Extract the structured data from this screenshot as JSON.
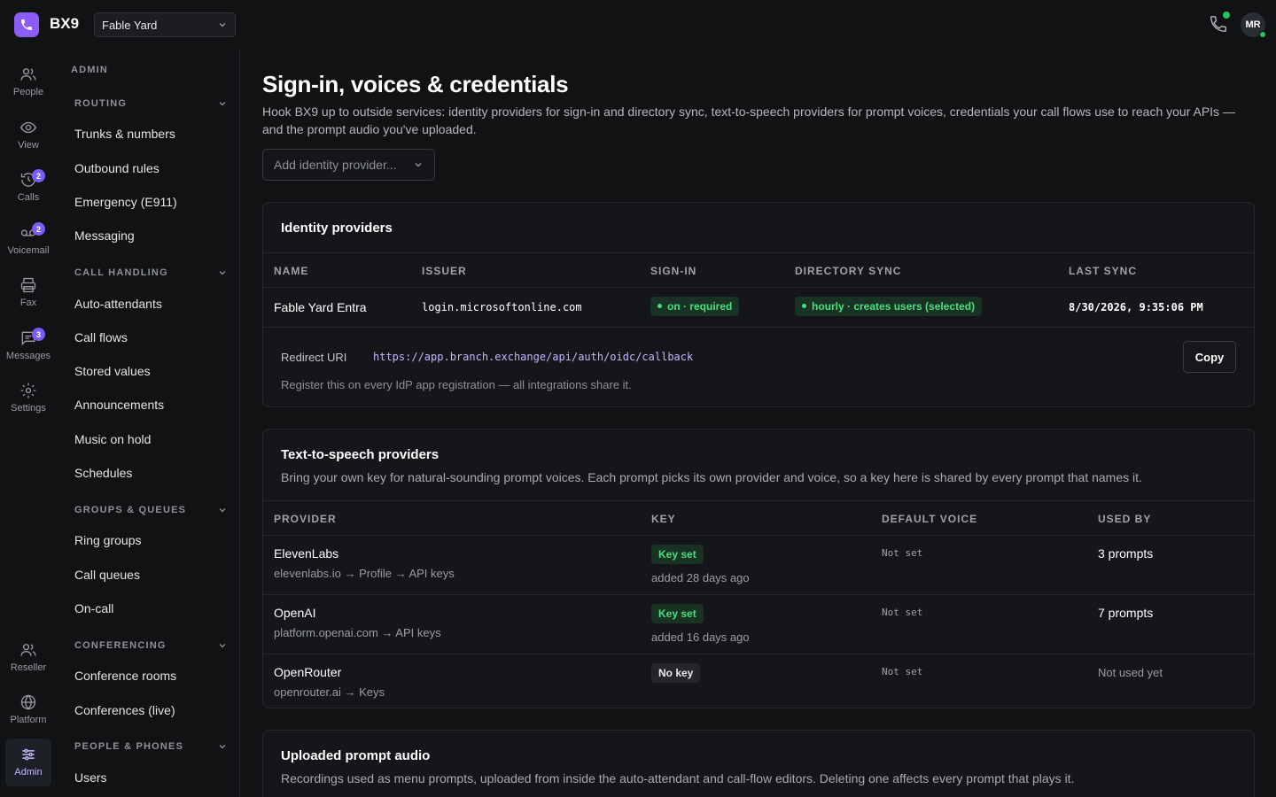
{
  "app": {
    "name": "BX9",
    "org": "Fable Yard",
    "user_initials": "MR"
  },
  "rail": [
    {
      "label": "People",
      "icon": "people-icon"
    },
    {
      "label": "View",
      "icon": "eye-icon"
    },
    {
      "label": "Calls",
      "icon": "history-icon",
      "badge": "2"
    },
    {
      "label": "Voicemail",
      "icon": "voicemail-icon",
      "badge": "2"
    },
    {
      "label": "Fax",
      "icon": "printer-icon"
    },
    {
      "label": "Messages",
      "icon": "message-icon",
      "badge": "3"
    },
    {
      "label": "Settings",
      "icon": "gear-icon"
    },
    {
      "label": "Reseller",
      "icon": "people-icon"
    },
    {
      "label": "Platform",
      "icon": "globe-icon"
    },
    {
      "label": "Admin",
      "icon": "sliders-icon"
    }
  ],
  "nav": {
    "admin_label": "ADMIN",
    "sections": [
      {
        "title": "ROUTING",
        "items": [
          "Trunks & numbers",
          "Outbound rules",
          "Emergency (E911)",
          "Messaging"
        ]
      },
      {
        "title": "CALL HANDLING",
        "items": [
          "Auto-attendants",
          "Call flows",
          "Stored values",
          "Announcements",
          "Music on hold",
          "Schedules"
        ]
      },
      {
        "title": "GROUPS & QUEUES",
        "items": [
          "Ring groups",
          "Call queues",
          "On-call"
        ]
      },
      {
        "title": "CONFERENCING",
        "items": [
          "Conference rooms",
          "Conferences (live)"
        ]
      },
      {
        "title": "PEOPLE & PHONES",
        "items": [
          "Users"
        ]
      }
    ]
  },
  "page": {
    "title": "Sign-in, voices & credentials",
    "description": "Hook BX9 up to outside services: identity providers for sign-in and directory sync, text-to-speech providers for prompt voices, credentials your call flows use to reach your APIs — and the prompt audio you've uploaded.",
    "add_idp_placeholder": "Add identity provider..."
  },
  "idp": {
    "title": "Identity providers",
    "columns": [
      "NAME",
      "ISSUER",
      "SIGN-IN",
      "DIRECTORY SYNC",
      "LAST SYNC"
    ],
    "row": {
      "name": "Fable Yard Entra",
      "issuer": "login.microsoftonline.com",
      "sign_in": "on · required",
      "directory_sync": "hourly · creates users (selected)",
      "last_sync": "8/30/2026, 9:35:06 PM"
    },
    "redirect_label": "Redirect URI",
    "redirect_uri": "https://app.branch.exchange/api/auth/oidc/callback",
    "redirect_note": "Register this on every IdP app registration — all integrations share it.",
    "copy_label": "Copy"
  },
  "tts": {
    "title": "Text-to-speech providers",
    "subtitle": "Bring your own key for natural-sounding prompt voices. Each prompt picks its own provider and voice, so a key here is shared by every prompt that names it.",
    "columns": [
      "PROVIDER",
      "KEY",
      "DEFAULT VOICE",
      "USED BY"
    ],
    "rows": [
      {
        "name": "ElevenLabs",
        "path": "elevenlabs.io → Profile → API keys",
        "key": "Key set",
        "key_note": "added 28 days ago",
        "voice": "Not set",
        "used_by": "3 prompts",
        "has_key": true
      },
      {
        "name": "OpenAI",
        "path": "platform.openai.com → API keys",
        "key": "Key set",
        "key_note": "added 16 days ago",
        "voice": "Not set",
        "used_by": "7 prompts",
        "has_key": true
      },
      {
        "name": "OpenRouter",
        "path": "openrouter.ai → Keys",
        "key": "No key",
        "key_note": "",
        "voice": "Not set",
        "used_by": "Not used yet",
        "has_key": false
      }
    ]
  },
  "audio": {
    "title": "Uploaded prompt audio",
    "subtitle": "Recordings used as menu prompts, uploaded from inside the auto-attendant and call-flow editors. Deleting one affects every prompt that plays it."
  }
}
